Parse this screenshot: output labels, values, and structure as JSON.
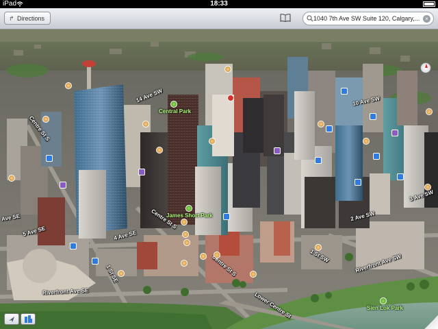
{
  "status_bar": {
    "carrier": "iPad",
    "time": "18:33"
  },
  "nav_bar": {
    "directions_label": "Directions",
    "search_value": "1040 7th Ave SW Suite 120, Calgary,..."
  },
  "map": {
    "view_mode": "3D flyover",
    "streets": [
      "14 Ave SW",
      "Centre St S",
      "10 Ave SW",
      "Ave SE",
      "5 Ave SE",
      "4 Ave SE",
      "Centre St S",
      "1 St SE",
      "Riverfront Ave SE",
      "Centre St S",
      "Lower Centre St",
      "3 Ave SW",
      "2 Ave SW",
      "1 St SW",
      "Riverfront Ave SW"
    ],
    "parks": [
      "Central Park",
      "James Short Park",
      "Sien Lok Park"
    ],
    "colors": {
      "park": "#6cc43a",
      "river": "#7fa48c",
      "poi_blue": "#2f7be2",
      "poi_purple": "#8a5bc4"
    }
  },
  "controls": {
    "compass_icon": "compass-icon",
    "locate_icon": "location-arrow-icon",
    "flyover_icon": "buildings-3d-icon",
    "page_curl": "page-curl-icon"
  }
}
